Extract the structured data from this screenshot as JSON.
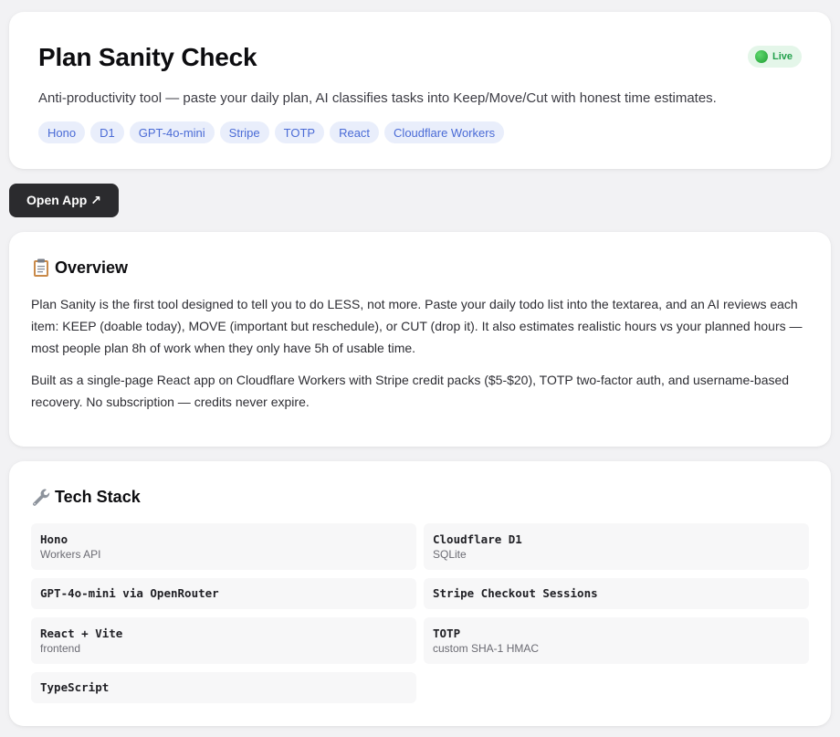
{
  "header": {
    "title": "Plan Sanity Check",
    "status": "Live",
    "description": "Anti-productivity tool — paste your daily plan, AI classifies tasks into Keep/Move/Cut with honest time estimates.",
    "tags": [
      "Hono",
      "D1",
      "GPT-4o-mini",
      "Stripe",
      "TOTP",
      "React",
      "Cloudflare Workers"
    ]
  },
  "open_button": {
    "label": "Open App ↗"
  },
  "overview": {
    "title": "Overview",
    "icon": "clipboard-icon",
    "paragraphs": [
      "Plan Sanity is the first tool designed to tell you to do LESS, not more. Paste your daily todo list into the textarea, and an AI reviews each item: KEEP (doable today), MOVE (important but reschedule), or CUT (drop it). It also estimates realistic hours vs your planned hours — most people plan 8h of work when they only have 5h of usable time.",
      "Built as a single-page React app on Cloudflare Workers with Stripe credit packs ($5-$20), TOTP two-factor auth, and username-based recovery. No subscription — credits never expire."
    ]
  },
  "tech_stack": {
    "title": "Tech Stack",
    "icon": "wrench-icon",
    "items": [
      {
        "name": "Hono",
        "sub": "Workers API"
      },
      {
        "name": "Cloudflare D1",
        "sub": "SQLite"
      },
      {
        "name": "GPT-4o-mini via OpenRouter",
        "sub": ""
      },
      {
        "name": "Stripe Checkout Sessions",
        "sub": ""
      },
      {
        "name": "React + Vite",
        "sub": "frontend"
      },
      {
        "name": "TOTP",
        "sub": "custom SHA-1 HMAC"
      },
      {
        "name": "TypeScript",
        "sub": ""
      }
    ]
  },
  "colors": {
    "tag_bg": "#e9eefb",
    "tag_text": "#4a6bd6",
    "live_bg": "#e4f6e9",
    "live_text": "#22a04b",
    "button_bg": "#2b2b2e"
  }
}
